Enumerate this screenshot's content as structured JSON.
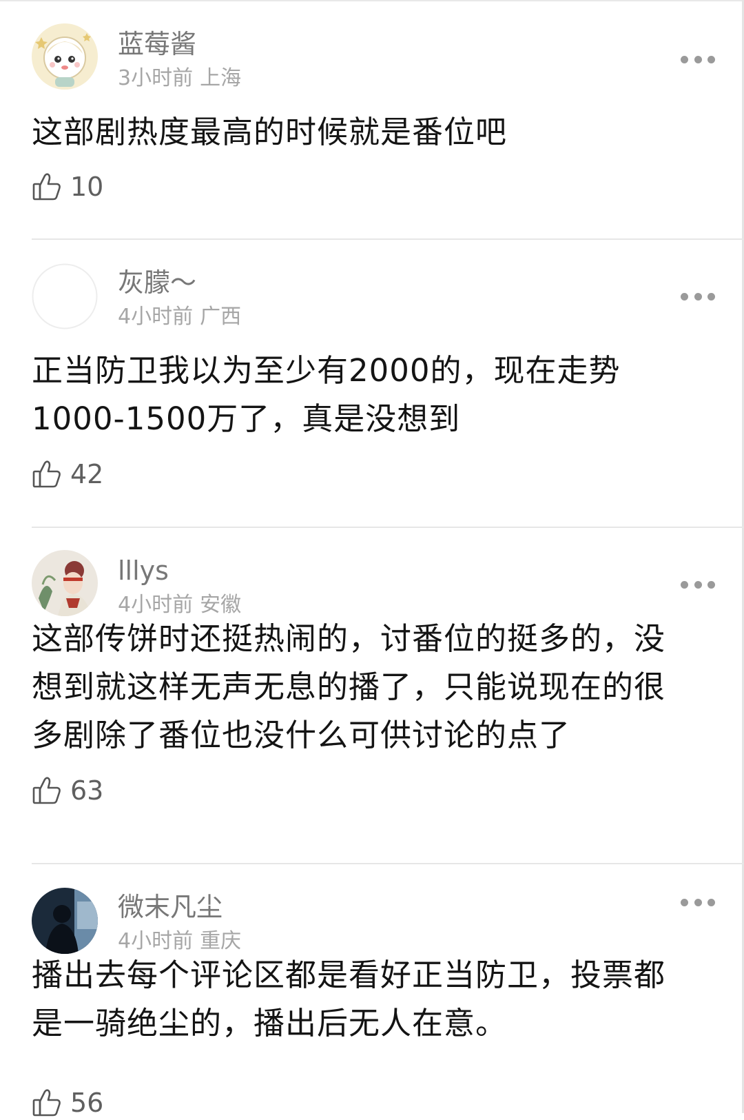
{
  "comments": [
    {
      "username": "蓝莓酱",
      "time": "3小时前",
      "location": "上海",
      "text": "这部剧热度最高的时候就是番位吧",
      "likes": "10",
      "avatar_icon": "cartoon-girl-avatar"
    },
    {
      "username": "灰朦～",
      "time": "4小时前",
      "location": "广西",
      "text": "正当防卫我以为至少有2000的，现在走势\n1000-1500万了，真是没想到",
      "likes": "42",
      "avatar_icon": "blank-avatar"
    },
    {
      "username": "lllys",
      "time": "4小时前",
      "location": "安徽",
      "text": "这部传饼时还挺热闹的，讨番位的挺多的，没\n想到就这样无声无息的播了，只能说现在的很\n多剧除了番位也没什么可供讨论的点了",
      "likes": "63",
      "avatar_icon": "costume-portrait-avatar"
    },
    {
      "username": "微末凡尘",
      "time": "4小时前",
      "location": "重庆",
      "text": "播出去每个评论区都是看好正当防卫，投票都\n是一骑绝尘的，播出后无人在意。",
      "likes": "56",
      "avatar_icon": "silhouette-window-avatar"
    }
  ],
  "icons": {
    "like": "thumbs-up-icon",
    "more": "more-dots-icon"
  },
  "colors": {
    "username": "#777777",
    "meta": "#a6a6a6",
    "body_text": "#141414",
    "divider": "#e6e6e6"
  }
}
